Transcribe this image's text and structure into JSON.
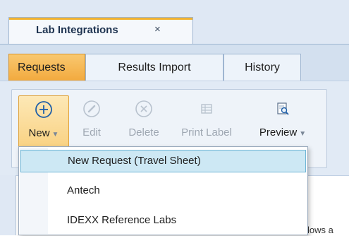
{
  "document_tab": {
    "title": "Lab Integrations",
    "close_glyph": "×"
  },
  "section_tabs": [
    {
      "label": "Requests",
      "active": true
    },
    {
      "label": "Results Import",
      "active": false
    },
    {
      "label": "History",
      "active": false
    }
  ],
  "ribbon": {
    "buttons": [
      {
        "label": "New",
        "icon": "plus-circle-icon",
        "enabled": true,
        "dropdown": true
      },
      {
        "label": "Edit",
        "icon": "pencil-circle-icon",
        "enabled": false,
        "dropdown": false
      },
      {
        "label": "Delete",
        "icon": "x-circle-icon",
        "enabled": false,
        "dropdown": false
      },
      {
        "label": "Print Label",
        "icon": "label-grid-icon",
        "enabled": false,
        "dropdown": false
      },
      {
        "label": "Preview",
        "icon": "preview-magnifier-icon",
        "enabled": true,
        "dropdown": true
      }
    ]
  },
  "new_menu": {
    "items": [
      {
        "label": "New Request (Travel Sheet)",
        "highlighted": true
      },
      {
        "label": "Antech",
        "highlighted": false
      },
      {
        "label": "IDEXX Reference Labs",
        "highlighted": false
      }
    ]
  },
  "background_peek_text": "lows a",
  "colors": {
    "active_tab": "#f2a93d",
    "accent": "#f2b330",
    "menu_highlight": "#cde8f4",
    "icon_blue": "#1f5fa8",
    "disabled": "#9ea7b2"
  }
}
